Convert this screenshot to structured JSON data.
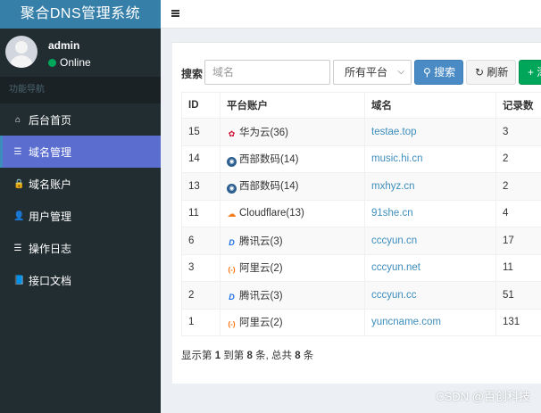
{
  "app": {
    "title": "聚合DNS管理系统"
  },
  "user": {
    "name": "admin",
    "status": "Online"
  },
  "nav": {
    "header": "功能导航",
    "items": [
      {
        "label": "后台首页",
        "icon": "home-icon",
        "glyph": "⌂"
      },
      {
        "label": "域名管理",
        "icon": "list-icon",
        "glyph": "☰",
        "active": true
      },
      {
        "label": "域名账户",
        "icon": "lock-icon",
        "glyph": "🔒"
      },
      {
        "label": "用户管理",
        "icon": "user-icon",
        "glyph": "👤"
      },
      {
        "label": "操作日志",
        "icon": "list-icon",
        "glyph": "☰"
      },
      {
        "label": "接口文档",
        "icon": "book-icon",
        "glyph": "📘"
      }
    ]
  },
  "search": {
    "label": "搜索",
    "placeholder": "域名",
    "platform_selected": "所有平台",
    "search_button": "搜索",
    "refresh_button": "刷新",
    "add_button": "添"
  },
  "table": {
    "columns": [
      "ID",
      "平台账户",
      "域名",
      "记录数"
    ],
    "rows": [
      {
        "id": "15",
        "platform": "华为云(36)",
        "icon": "huawei-icon",
        "domain": "testae.top",
        "records": "3"
      },
      {
        "id": "14",
        "platform": "西部数码(14)",
        "icon": "west-digital-icon",
        "domain": "music.hi.cn",
        "records": "2"
      },
      {
        "id": "13",
        "platform": "西部数码(14)",
        "icon": "west-digital-icon",
        "domain": "mxhyz.cn",
        "records": "2"
      },
      {
        "id": "11",
        "platform": "Cloudflare(13)",
        "icon": "cloudflare-icon",
        "domain": "91she.cn",
        "records": "4"
      },
      {
        "id": "6",
        "platform": "腾讯云(3)",
        "icon": "tencent-cloud-icon",
        "domain": "cccyun.cn",
        "records": "17"
      },
      {
        "id": "3",
        "platform": "阿里云(2)",
        "icon": "aliyun-icon",
        "domain": "cccyun.net",
        "records": "11"
      },
      {
        "id": "2",
        "platform": "腾讯云(3)",
        "icon": "tencent-cloud-icon",
        "domain": "cccyun.cc",
        "records": "51"
      },
      {
        "id": "1",
        "platform": "阿里云(2)",
        "icon": "aliyun-icon",
        "domain": "yuncname.com",
        "records": "131"
      }
    ]
  },
  "pagination": {
    "prefix": "显示第 ",
    "from": "1",
    "mid1": " 到第 ",
    "to": "8",
    "mid2": " 条, 总共 ",
    "total": "8",
    "suffix": " 条"
  },
  "watermark": "CSDN @百创科技"
}
